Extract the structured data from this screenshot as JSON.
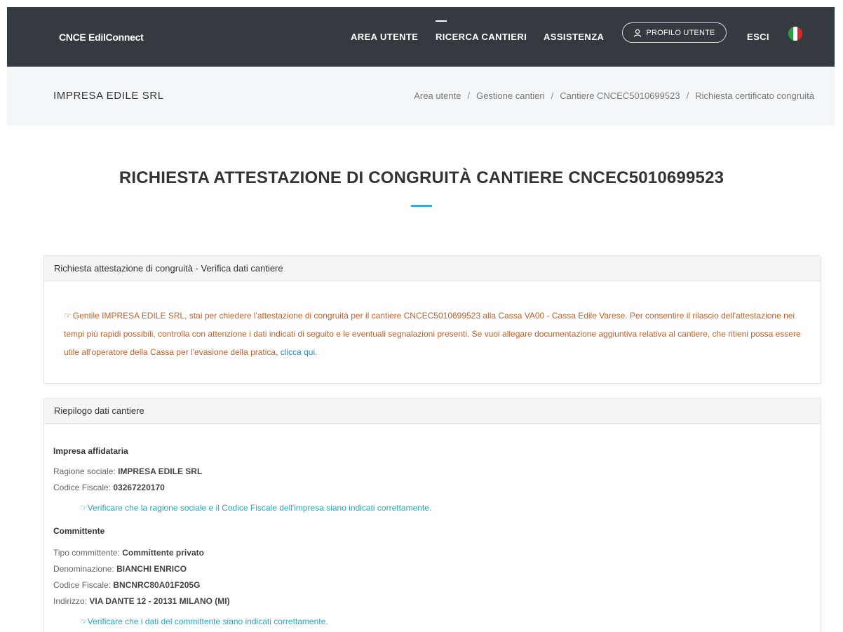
{
  "nav": {
    "brand": "CNCE EdilConnect",
    "area_utente": "AREA UTENTE",
    "ricerca_cantieri": "RICERCA CANTIERI",
    "assistenza": "ASSISTENZA",
    "profilo_utente": "PROFILO UTENTE",
    "esci": "ESCI"
  },
  "subheader": {
    "company": "IMPRESA EDILE SRL",
    "breadcrumb": [
      "Area utente",
      "Gestione cantieri",
      "Cantiere CNCEC5010699523",
      "Richiesta certificato congruità"
    ],
    "separator": "/"
  },
  "page": {
    "title": "RICHIESTA ATTESTAZIONE DI CONGRUITÀ CANTIERE CNCEC5010699523"
  },
  "card1": {
    "header": "Richiesta attestazione di congruità - Verifica dati cantiere",
    "notice_icon": "☞",
    "notice_text": "Gentile IMPRESA EDILE SRL, stai per chiedere l'attestazione di congruità per il cantiere CNCEC5010699523 alla Cassa VA00 - Cassa Edile Varese. Per consentire il rilascio dell'attestazione nei tempi più rapidi possibili, controlla con attenzione i dati indicati di seguito e le eventuali segnalazioni presenti. Se vuoi allegare documentazione aggiuntiva relativa al cantiere, che ritieni possa essere utile all'operatore della Cassa per l'evasione della pratica, ",
    "notice_link": "clicca qui."
  },
  "card2": {
    "header": "Riepilogo dati cantiere",
    "impresa": {
      "title": "Impresa affidataria",
      "ragione_label": "Ragione sociale: ",
      "ragione_value": "IMPRESA EDILE SRL",
      "cf_label": "Codice Fiscale: ",
      "cf_value": "03267220170",
      "hint": "Verificare che la ragione sociale e il Codice Fiscale dell'impresa siano indicati correttamente."
    },
    "committente": {
      "title": "Committente",
      "tipo_label": "Tipo committente: ",
      "tipo_value": "Committente privato",
      "denom_label": "Denominazione: ",
      "denom_value": "BIANCHI ENRICO",
      "cf_label": "Codice Fiscale: ",
      "cf_value": "BNCNRC80A01F205G",
      "indirizzo_label": "Indirizzo: ",
      "indirizzo_value": "VIA DANTE 12 - 20131 MILANO (MI)",
      "hint": "Verificare che i dati del committente siano indicati correttamente."
    },
    "hint_icon": "☞"
  },
  "colors": {
    "topbar": "#343a40",
    "subheader": "#f4f7f9",
    "accent": "#3aa6d8",
    "notice": "#c0612b",
    "hint": "#2aa6b8",
    "link": "#2a88c8"
  },
  "icons": {
    "profile": "user-icon",
    "flag": "italian-flag-icon",
    "notice": "hand-pointing-icon"
  }
}
